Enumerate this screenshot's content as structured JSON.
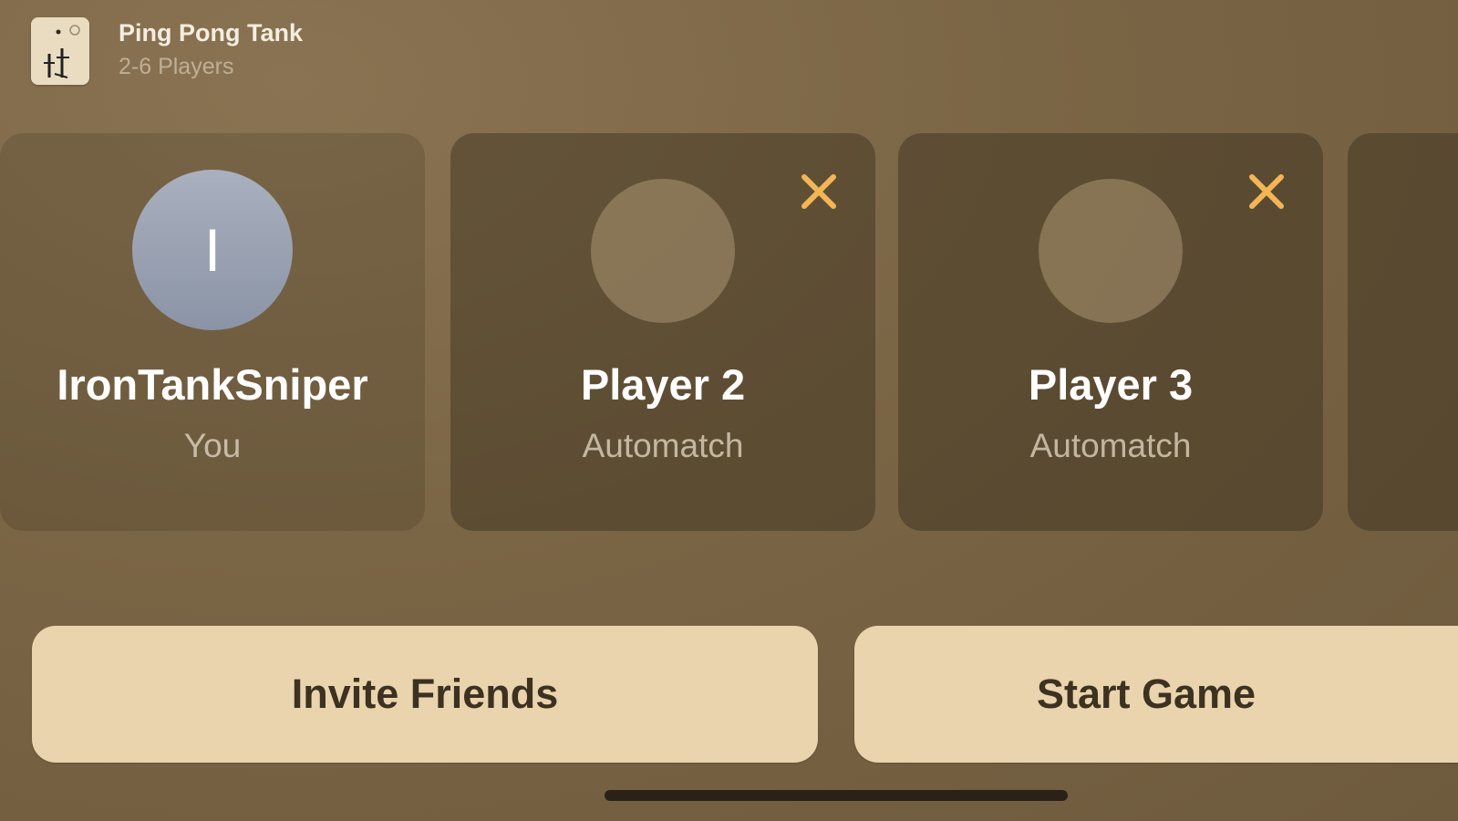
{
  "header": {
    "title": "Ping Pong Tank",
    "subtitle": "2-6 Players"
  },
  "players": [
    {
      "initial": "I",
      "name": "IronTankSniper",
      "role": "You"
    },
    {
      "name": "Player 2",
      "role": "Automatch"
    },
    {
      "name": "Player 3",
      "role": "Automatch"
    }
  ],
  "buttons": {
    "invite": "Invite Friends",
    "start": "Start Game"
  },
  "colors": {
    "accent": "#f2b657",
    "button_bg": "#ead4ad",
    "button_text": "#3d3221"
  },
  "icons": {
    "remove": "close-icon",
    "game": "game-app-icon"
  }
}
